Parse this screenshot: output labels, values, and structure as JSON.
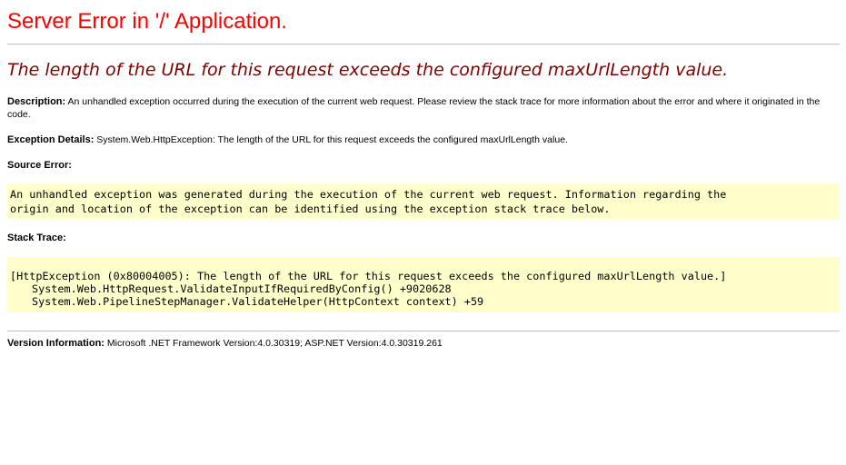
{
  "page": {
    "title": "Server Error in '/' Application.",
    "error_message": "The length of the URL for this request exceeds the configured maxUrlLength value."
  },
  "description": {
    "label": "Description:",
    "text": " An unhandled exception occurred during the execution of the current web request. Please review the stack trace for more information about the error and where it originated in the code."
  },
  "exception_details": {
    "label": "Exception Details:",
    "text": " System.Web.HttpException: The length of the URL for this request exceeds the configured maxUrlLength value."
  },
  "source_error": {
    "label": "Source Error:",
    "lines": [
      "An unhandled exception was generated during the execution of the current web request. Information regarding the",
      "origin and location of the exception can be identified using the exception stack trace below."
    ]
  },
  "stack_trace": {
    "label": "Stack Trace:",
    "exception_line": "[HttpException (0x80004005): The length of the URL for this request exceeds the configured maxUrlLength value.]",
    "frames": [
      "System.Web.HttpRequest.ValidateInputIfRequiredByConfig() +9020628",
      "System.Web.PipelineStepManager.ValidateHelper(HttpContext context) +59"
    ]
  },
  "version_information": {
    "label": "Version Information:",
    "text": " Microsoft .NET Framework Version:4.0.30319; ASP.NET Version:4.0.30319.261"
  },
  "colors": {
    "title": "#ff0000",
    "error_message": "#800000",
    "code_background": "#ffffcc",
    "rule": "#c0c0c0"
  }
}
